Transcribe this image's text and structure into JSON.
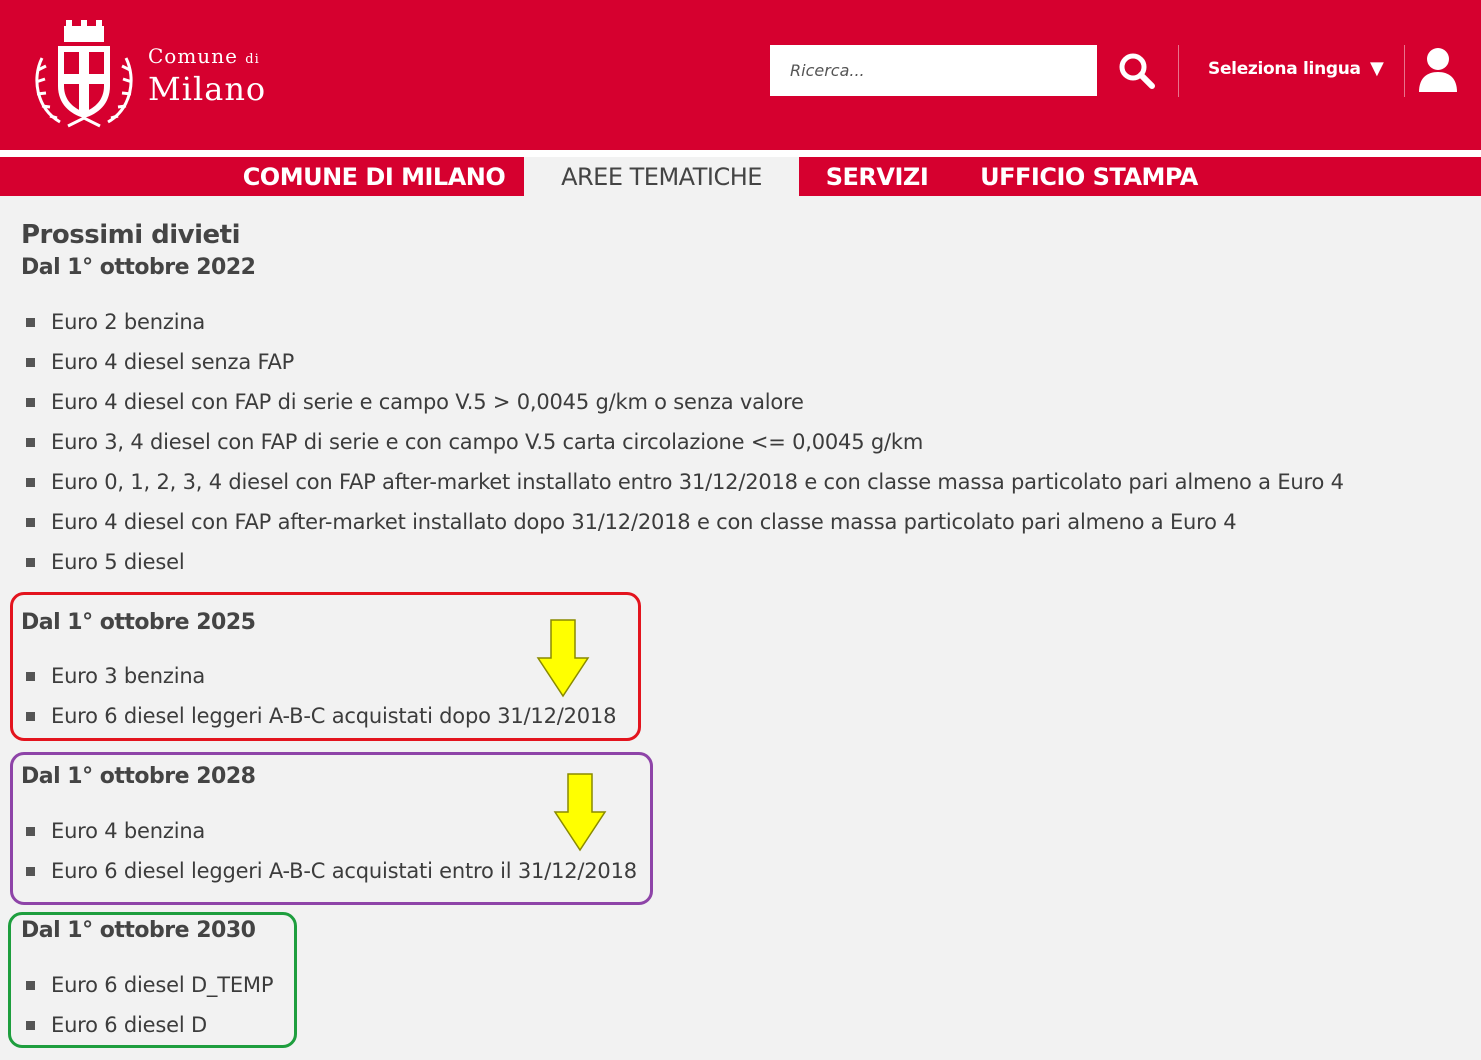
{
  "header": {
    "logo_line1": "Comune",
    "logo_line1_small": "di",
    "logo_line2": "Milano",
    "search_placeholder": "Ricerca...",
    "language_label": "Seleziona lingua",
    "language_arrow": "▼",
    "brand_color": "#d6002f"
  },
  "nav": {
    "items": [
      {
        "label": "COMUNE DI MILANO",
        "active": false
      },
      {
        "label": "AREE TEMATICHE",
        "active": true
      },
      {
        "label": "SERVIZI",
        "active": false
      },
      {
        "label": "UFFICIO STAMPA",
        "active": false
      }
    ]
  },
  "content": {
    "title": "Prossimi divieti",
    "sections": [
      {
        "heading": "Dal 1° ottobre 2022",
        "items": [
          "Euro 2 benzina",
          "Euro 4 diesel senza FAP",
          "Euro 4 diesel con FAP di serie e campo V.5 > 0,0045 g/km o senza valore",
          "Euro 3, 4 diesel con FAP di serie e con campo V.5 carta circolazione <= 0,0045 g/km",
          "Euro 0, 1, 2, 3, 4 diesel con FAP after-market installato entro 31/12/2018 e con classe massa particolato pari almeno a Euro 4",
          "Euro 4 diesel con FAP after-market installato dopo 31/12/2018 e con classe massa particolato pari almeno a Euro 4",
          "Euro 5 diesel"
        ]
      },
      {
        "heading": "Dal 1° ottobre 2025",
        "items": [
          "Euro 3 benzina",
          "Euro 6 diesel leggeri A-B-C acquistati dopo 31/12/2018"
        ],
        "frame_color": "#e3141e"
      },
      {
        "heading": "Dal 1° ottobre 2028",
        "items": [
          "Euro 4 benzina",
          "Euro 6 diesel leggeri A-B-C acquistati entro il 31/12/2018"
        ],
        "frame_color": "#8e44a8"
      },
      {
        "heading": "Dal 1° ottobre 2030",
        "items": [
          "Euro 6 diesel D_TEMP",
          "Euro 6 diesel D"
        ],
        "frame_color": "#1e9e3e"
      }
    ],
    "annotation_arrow_color": "#ffff00"
  }
}
